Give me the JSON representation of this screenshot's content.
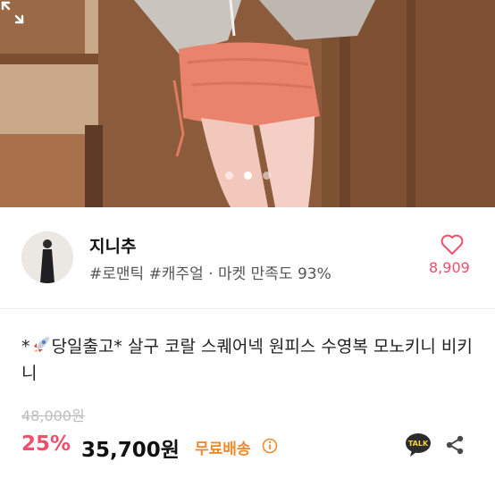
{
  "gallery": {
    "total_images": 3,
    "active_index": 2
  },
  "seller": {
    "name": "지니추",
    "tags": "#로맨틱 #캐주얼 · 마켓 만족도 93%",
    "likes": "8,909"
  },
  "product": {
    "title_prefix": "*",
    "title_text": "당일출고* 살구 코랄 스퀘어넥 원피스 수영복 모노키니 비키니",
    "original_price": "48,000원",
    "discount": "25%",
    "price": "35,700원",
    "shipping": "무료배송"
  },
  "actions": {
    "talk_label": "TALK"
  },
  "colors": {
    "accent": "#ef4f6b",
    "shipping": "#f08b2d"
  }
}
